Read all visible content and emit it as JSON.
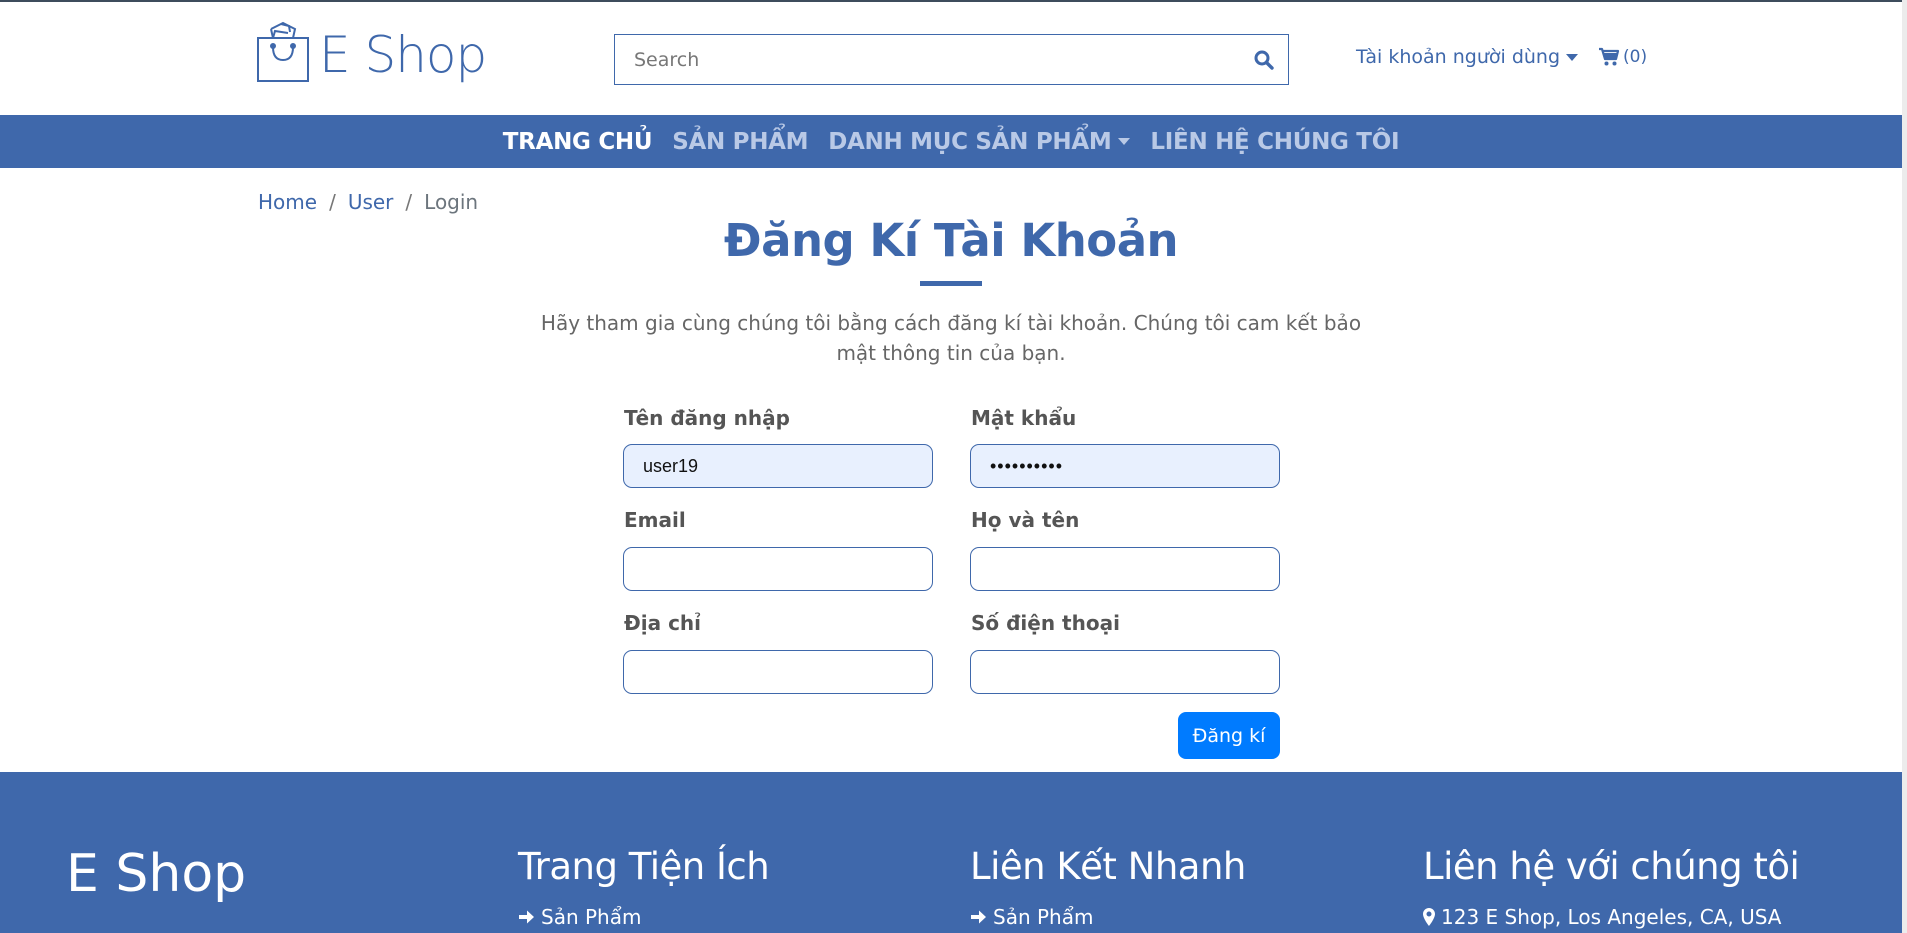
{
  "header": {
    "logo_text": "E Shop",
    "search_placeholder": "Search",
    "account_label": "Tài khoản người dùng",
    "cart_label": "(0)"
  },
  "nav": {
    "items": [
      {
        "label": "TRANG CHỦ",
        "active": true
      },
      {
        "label": "SẢN PHẨM",
        "active": false
      },
      {
        "label": "DANH MỤC SẢN PHẨM",
        "active": false,
        "dropdown": true
      },
      {
        "label": "LIÊN HỆ CHÚNG TÔI",
        "active": false
      }
    ]
  },
  "breadcrumb": {
    "items": [
      "Home",
      "User",
      "Login"
    ],
    "separator": "/"
  },
  "page": {
    "title": "Đăng Kí Tài Khoản",
    "intro": "Hãy tham gia cùng chúng tôi bằng cách đăng kí tài khoản. Chúng tôi cam kết bảo mật thông tin của bạn."
  },
  "form": {
    "username_label": "Tên đăng nhập",
    "username_value": "user19",
    "password_label": "Mật khẩu",
    "password_value": "••••••••••",
    "email_label": "Email",
    "email_value": "",
    "fullname_label": "Họ và tên",
    "fullname_value": "",
    "address_label": "Địa chỉ",
    "address_value": "",
    "phone_label": "Số điện thoại",
    "phone_value": "",
    "submit_label": "Đăng kí"
  },
  "footer": {
    "brand": "E Shop",
    "col1_heading": "Trang Tiện Ích",
    "col1_link": "Sản Phẩm",
    "col2_heading": "Liên Kết Nhanh",
    "col2_link": "Sản Phẩm",
    "col3_heading": "Liên hệ với chúng tôi",
    "col3_address": "123 E Shop, Los Angeles, CA, USA"
  },
  "colors": {
    "brand": "#3f68ab",
    "nav_inactive": "#b9c9e6",
    "submit": "#007bff",
    "autofill": "#e8f0fe"
  },
  "icons": [
    "shopping-bag-icon",
    "search-icon",
    "caret-down-icon",
    "cart-icon",
    "arrow-right-icon",
    "map-marker-icon"
  ]
}
